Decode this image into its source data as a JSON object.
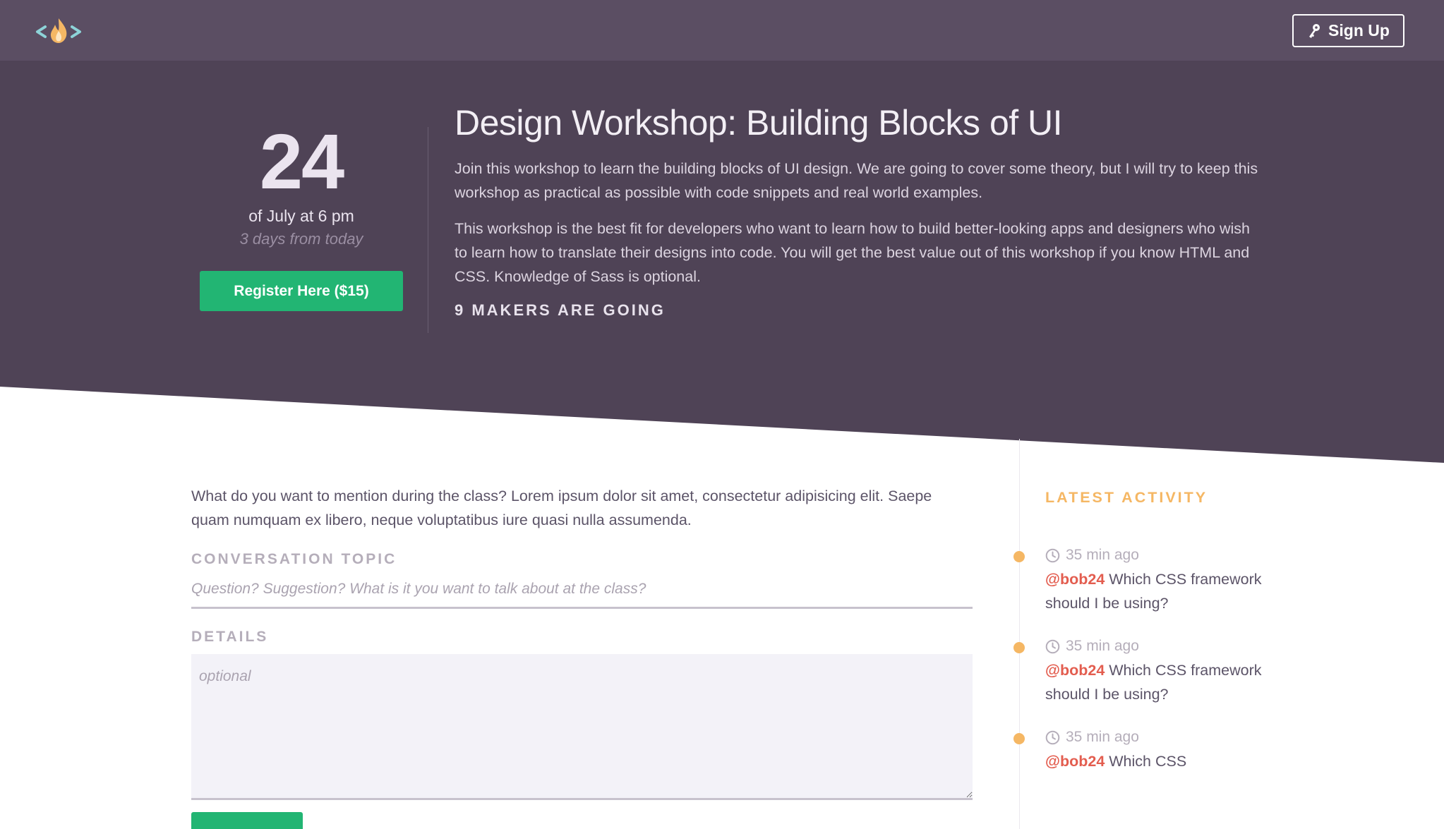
{
  "header": {
    "logo_icon": "flame-code-logo-icon",
    "signup_icon": "key-icon",
    "signup_label": "Sign Up"
  },
  "event": {
    "day": "24",
    "date_text": "of July at 6 pm",
    "relative": "3 days from today",
    "register_label": "Register Here ($15)",
    "title": "Design Workshop: Building Blocks of UI",
    "paragraphs": [
      "Join this workshop to learn the building blocks of UI design. We are going to cover some theory, but I will try to keep this workshop as practical as possible with code snippets and real world examples.",
      "This workshop is the best fit for developers who want to learn how to build better-looking apps and designers who wish to learn how to translate their designs into code. You will get the best value out of this workshop if you know HTML and CSS. Knowledge of Sass is optional."
    ],
    "attendees": "9 MAKERS ARE GOING"
  },
  "form": {
    "intro": "What do you want to mention during the class? Lorem ipsum dolor sit amet, consectetur adipisicing elit. Saepe quam numquam ex libero, neque voluptatibus iure quasi nulla assumenda.",
    "topic_label": "CONVERSATION TOPIC",
    "topic_placeholder": "Question? Suggestion? What is it you want to talk about at the class?",
    "details_label": "DETAILS",
    "details_placeholder": "optional"
  },
  "activity": {
    "heading": "LATEST ACTIVITY",
    "items": [
      {
        "time": "35 min ago",
        "user": "@bob24",
        "text": "Which CSS framework should I be using?"
      },
      {
        "time": "35 min ago",
        "user": "@bob24",
        "text": "Which CSS framework should I be using?"
      },
      {
        "time": "35 min ago",
        "user": "@bob24",
        "text": "Which CSS"
      }
    ]
  },
  "colors": {
    "topbar": "#5b4e63",
    "hero": "#4f4356",
    "accent_green": "#22b573",
    "activity_orange": "#f5b764",
    "mention_red": "#e35d4f"
  }
}
